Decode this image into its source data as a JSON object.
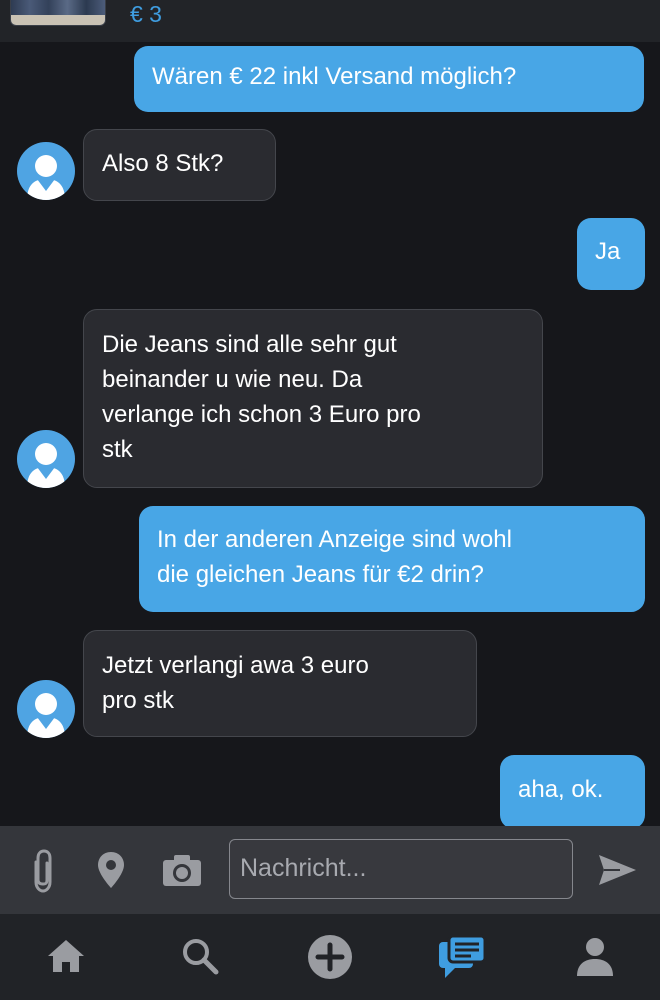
{
  "listing": {
    "price": "€ 3"
  },
  "messages": [
    {
      "side": "out",
      "text": "Wären € 22 inkl Versand möglich?"
    },
    {
      "side": "in",
      "text": "Also 8 Stk?"
    },
    {
      "side": "out",
      "text": "Ja"
    },
    {
      "side": "in",
      "lines": [
        "Die Jeans sind alle sehr gut",
        "beinander u wie neu. Da",
        "verlange ich schon 3 Euro pro",
        "stk"
      ]
    },
    {
      "side": "out",
      "lines": [
        "In der anderen Anzeige sind wohl",
        "die gleichen Jeans für €2 drin?"
      ]
    },
    {
      "side": "in",
      "lines": [
        "Jetzt verlangi awa 3 euro",
        "pro stk"
      ]
    },
    {
      "side": "out",
      "text": "aha, ok."
    }
  ],
  "composer": {
    "placeholder": "Nachricht...",
    "icons": [
      "paperclip-icon",
      "location-pin-icon",
      "camera-icon",
      "send-icon"
    ]
  },
  "nav": {
    "items": [
      "home-icon",
      "search-icon",
      "add-icon",
      "messages-icon",
      "profile-icon"
    ],
    "active": "messages-icon"
  },
  "colors": {
    "accent": "#48a6e6",
    "background": "#16171b",
    "incoming_bubble": "#2a2b30",
    "nav_active": "#3f9de0",
    "nav_inactive": "#9a9ca1"
  }
}
